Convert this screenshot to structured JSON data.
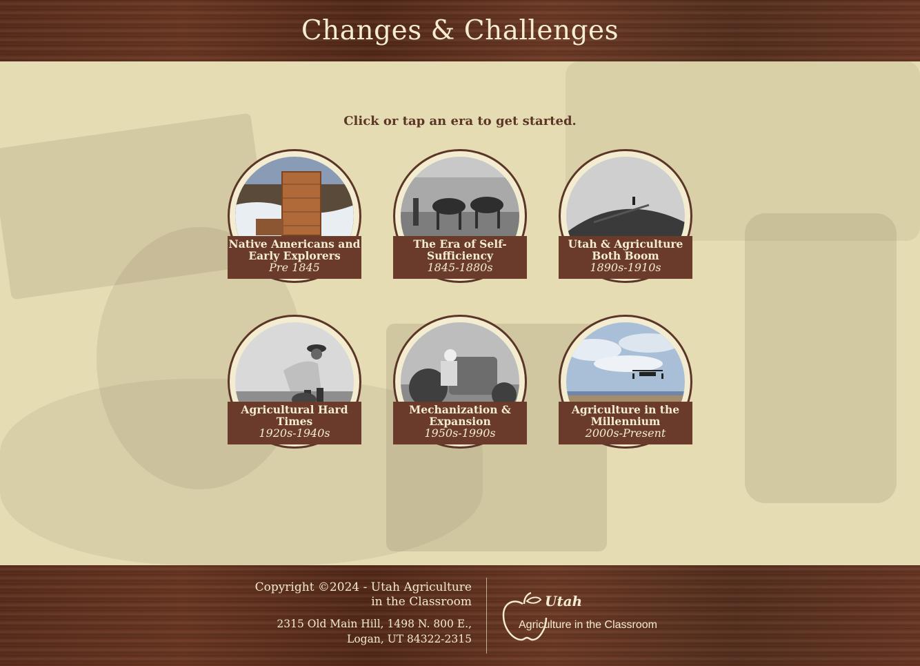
{
  "header": {
    "title": "Changes & Challenges"
  },
  "main": {
    "prompt": "Click or tap an era to get started.",
    "eras": [
      {
        "name_line1": "Native Americans and",
        "name_line2": "Early Explorers",
        "years": "Pre 1845",
        "icon": "ruins-icon"
      },
      {
        "name_line1": "The Era of Self-",
        "name_line2": "Sufficiency",
        "years": "1845-1880s",
        "icon": "horses-plow-icon"
      },
      {
        "name_line1": "Utah & Agriculture",
        "name_line2": "Both Boom",
        "years": "1890s-1910s",
        "icon": "harvest-pile-icon"
      },
      {
        "name_line1": "Agricultural Hard",
        "name_line2": "Times",
        "years": "1920s-1940s",
        "icon": "farmer-icon"
      },
      {
        "name_line1": "Mechanization &",
        "name_line2": "Expansion",
        "years": "1950s-1990s",
        "icon": "tractor-icon"
      },
      {
        "name_line1": "Agriculture in the",
        "name_line2": "Millennium",
        "years": "2000s-Present",
        "icon": "drone-icon"
      }
    ]
  },
  "footer": {
    "copyright_line1": "Copyright ©2024 - Utah Agriculture",
    "copyright_line2": "in the Classroom",
    "address_line1": "2315 Old Main Hill, 1498 N. 800 E.,",
    "address_line2": "Logan, UT 84322-2315",
    "logo_top": "Utah",
    "logo_bottom": "Agriculture in the Classroom"
  },
  "colors": {
    "wood": "#5c2f1e",
    "label_bg": "#6a3b2b",
    "cream": "#f5ecd3",
    "parchment": "#e6dcb3"
  }
}
